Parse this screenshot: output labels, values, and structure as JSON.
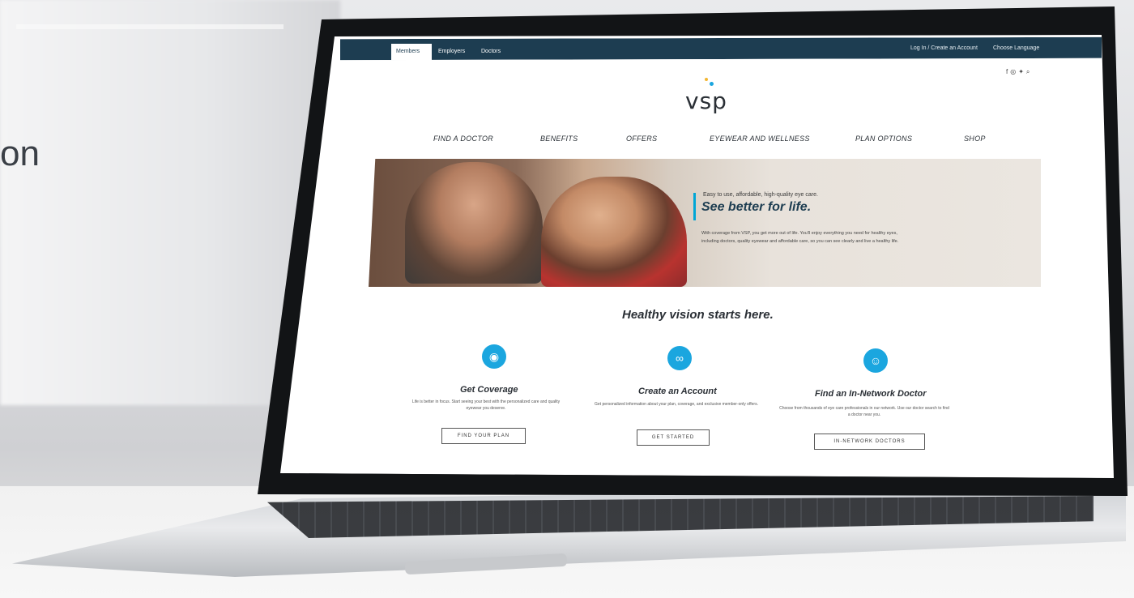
{
  "background": {
    "partial_text": "on"
  },
  "site": {
    "topbar": {
      "tabs": [
        "Members",
        "Employers",
        "Doctors"
      ],
      "active_tab_index": 0,
      "utility": {
        "login": "Log In / Create an Account",
        "language": "Choose Language"
      }
    },
    "logo": "vsp",
    "nav": [
      "FIND A DOCTOR",
      "BENEFITS",
      "OFFERS",
      "EYEWEAR AND WELLNESS",
      "PLAN OPTIONS",
      "SHOP"
    ],
    "hero": {
      "eyebrow": "Easy to use, affordable, high-quality eye care.",
      "title": "See better for life.",
      "body": "With coverage from VSP, you get more out of life. You'll enjoy everything you need for healthy eyes, including doctors, quality eyewear and affordable care, so you can see clearly and live a healthy life."
    },
    "section_title": "Healthy vision starts here.",
    "cards": [
      {
        "title": "Get Coverage",
        "body": "Life is better in focus. Start seeing your best with the personalized care and quality eyewear you deserve.",
        "button": "FIND YOUR PLAN",
        "icon": "shield-eye-icon"
      },
      {
        "title": "Create an Account",
        "body": "Get personalized information about your plan, coverage, and exclusive member-only offers.",
        "button": "GET STARTED",
        "icon": "glasses-icon"
      },
      {
        "title": "Find an In-Network Doctor",
        "body": "Choose from thousands of eye care professionals in our network. Use our doctor search to find a doctor near you.",
        "button": "IN-NETWORK DOCTORS",
        "icon": "doctor-icon"
      }
    ],
    "colors": {
      "topbar": "#1d3d51",
      "accent": "#1ba6df"
    }
  }
}
